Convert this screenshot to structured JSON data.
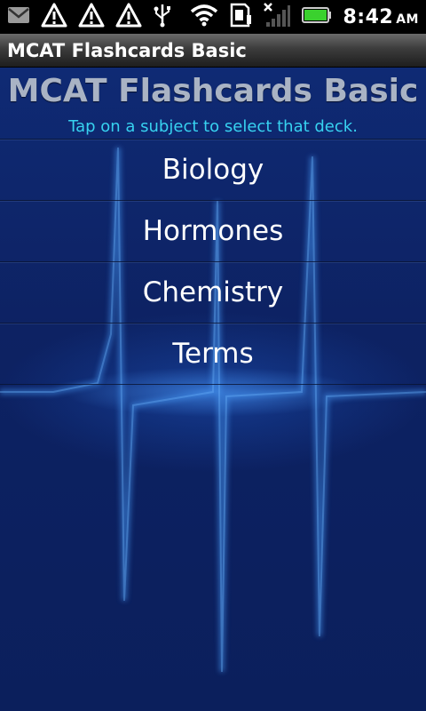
{
  "status_bar": {
    "icons": [
      "gmail-icon",
      "warning-icon",
      "warning-icon",
      "warning-icon",
      "usb-icon",
      "wifi-icon",
      "sd-card-icon",
      "no-signal-icon",
      "battery-icon"
    ],
    "time": "8:42",
    "ampm": "AM"
  },
  "titlebar": {
    "title": "MCAT Flashcards Basic"
  },
  "main": {
    "title": "MCAT Flashcards Basic",
    "subtitle": "Tap on a subject to select that deck.",
    "subjects": [
      "Biology",
      "Hormones",
      "Chemistry",
      "Terms"
    ]
  },
  "colors": {
    "accent": "#37d2f0",
    "background": "#0d2263",
    "title_gray": "#a9b3c4"
  }
}
